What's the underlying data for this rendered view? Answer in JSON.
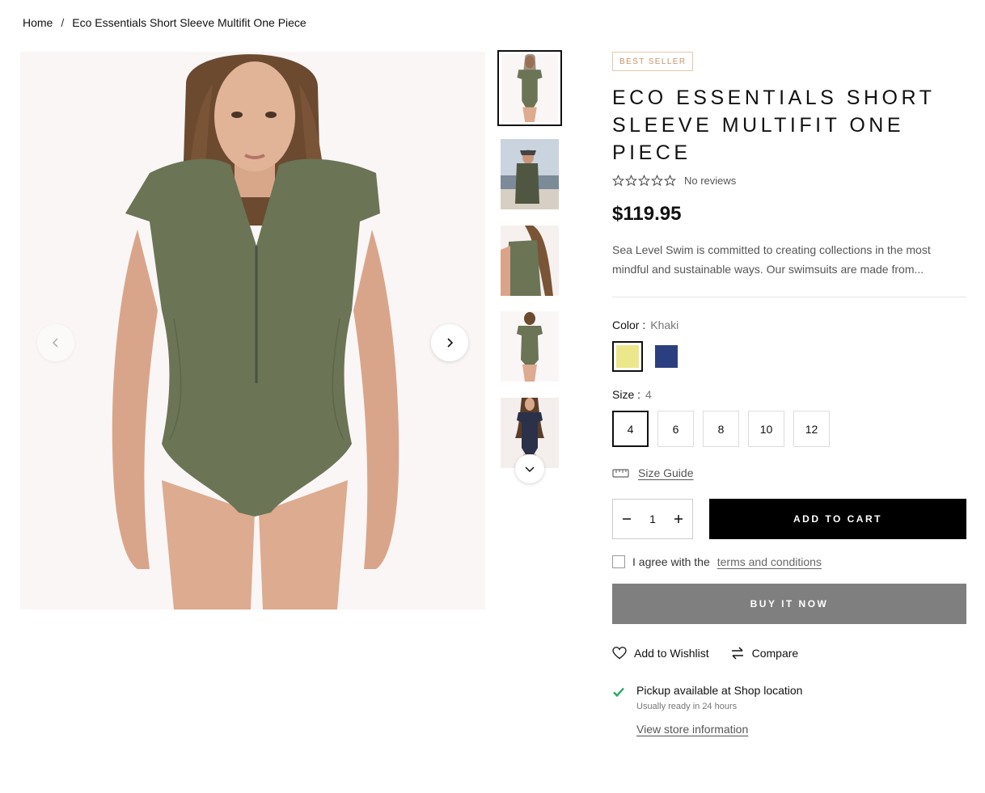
{
  "breadcrumb": {
    "home": "Home",
    "separator": "/",
    "current": "Eco Essentials Short Sleeve Multifit One Piece"
  },
  "gallery": {
    "main_image_alt": "model wearing khaki short sleeve one piece swimsuit",
    "thumbnails": [
      {
        "name": "thumbnail-front"
      },
      {
        "name": "thumbnail-beach"
      },
      {
        "name": "thumbnail-side"
      },
      {
        "name": "thumbnail-back"
      },
      {
        "name": "thumbnail-navy"
      }
    ]
  },
  "product": {
    "badge": "BEST SELLER",
    "title": "ECO ESSENTIALS SHORT SLEEVE MULTIFIT ONE PIECE",
    "reviews_text": "No reviews",
    "rating": 0,
    "price": "$119.95",
    "description": "Sea Level Swim is committed to creating collections in the most mindful and sustainable ways. Our swimsuits are made from..."
  },
  "color": {
    "label": "Color :",
    "selected": "Khaki",
    "swatches": [
      "#ece78a",
      "#2b3f80"
    ]
  },
  "size": {
    "label": "Size :",
    "selected": "4",
    "options": [
      "4",
      "6",
      "8",
      "10",
      "12"
    ]
  },
  "size_guide": "Size Guide",
  "quantity": "1",
  "add_to_cart": "ADD TO CART",
  "agree": {
    "prefix": "I agree with the",
    "link": "terms and conditions"
  },
  "buy_now": "BUY IT NOW",
  "wishlist": "Add to Wishlist",
  "compare": "Compare",
  "pickup": {
    "title": "Pickup available at Shop location",
    "subtitle": "Usually ready in 24 hours",
    "link": "View store information"
  },
  "colors": {
    "badge_border": "#e3c9ad",
    "badge_text": "#c8946a",
    "check_green": "#27a85f",
    "buy_now_bg": "#7f7f7f"
  }
}
